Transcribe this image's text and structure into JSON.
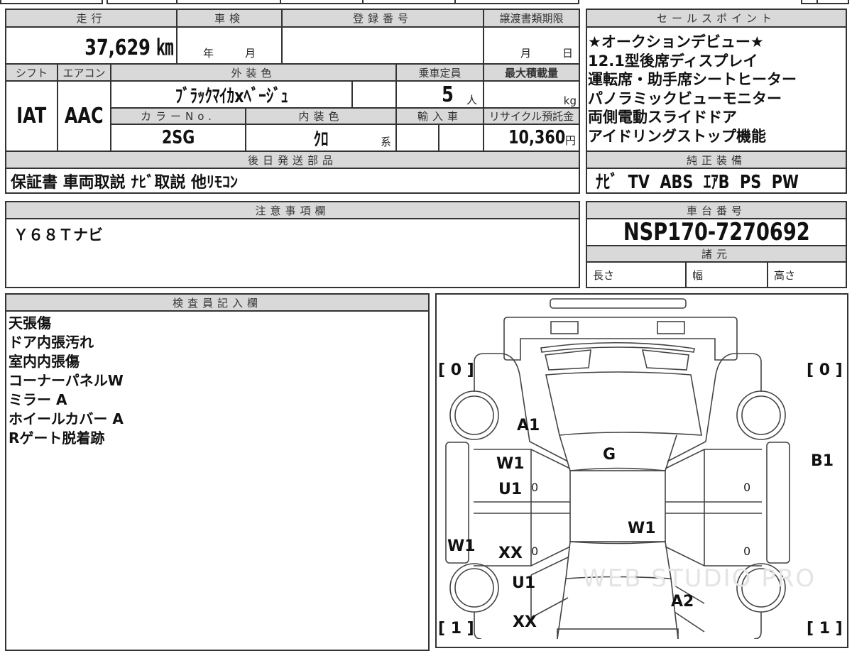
{
  "vehicle": {
    "mileage_label": "走行",
    "mileage_value": "37,629 ㎞",
    "inspection_label": "車検",
    "inspection_year": "年",
    "inspection_month": "月",
    "registration_label": "登録番号",
    "transfer_deadline_label": "譲渡書類期限",
    "transfer_month": "月",
    "transfer_day": "日",
    "shift_label": "シフト",
    "shift_value": "IAT",
    "aircon_label": "エアコン",
    "aircon_value": "AAC",
    "exterior_color_label": "外装色",
    "exterior_color_value": "ﾌﾞﾗｯｸﾏｲｶxﾍﾞｰｼﾞｭ",
    "capacity_label": "乗車定員",
    "capacity_value": "5",
    "capacity_unit": "人",
    "max_load_label": "最大積載量",
    "max_load_unit": "kg",
    "color_no_label": "カラーNo.",
    "color_no_value": "2SG",
    "interior_color_label": "内装色",
    "interior_color_value": "ｸﾛ",
    "interior_color_suffix": "系",
    "import_label": "輸入車",
    "recycle_label": "リサイクル預託金",
    "recycle_value": "10,360",
    "recycle_unit": "円",
    "later_parts_label": "後日発送部品",
    "later_parts_value": "保証書 車両取説 ﾅﾋﾞ取説 他ﾘﾓｺﾝ"
  },
  "sales_points": {
    "label": "セールスポイント",
    "items": [
      "★オークションデビュー★",
      "12.1型後席ディスプレイ",
      "運転席・助手席シートヒーター",
      "パノラミックビューモニター",
      "両側電動スライドドア",
      "アイドリングストップ機能"
    ]
  },
  "equipment": {
    "label": "純正装備",
    "value": "ﾅﾋﾞ  TV  ABS  ｴｱB  PS  PW"
  },
  "notes": {
    "label": "注意事項欄",
    "value": "Ｙ６８Ｔナビ"
  },
  "chassis": {
    "label": "車台番号",
    "value": "NSP170-7270692",
    "spec_label": "諸元",
    "length": "長さ",
    "width": "幅",
    "height": "高さ"
  },
  "inspector": {
    "label": "検査員記入欄",
    "items": [
      "天張傷",
      "ドア内張汚れ",
      "室内内張傷",
      "コーナーパネルW",
      "ミラー A",
      "ホイールカバー A",
      "Rゲート脱着跡"
    ]
  },
  "diagram": {
    "tires": {
      "front_left": "[ 0 ]",
      "front_right": "[ 0 ]",
      "rear_left": "[ 1 ]",
      "rear_right": "[ 1 ]"
    },
    "marks": {
      "a1": "A1",
      "g": "G",
      "w1_fl_door": "W1",
      "u1_fl_door": "U1",
      "b1": "B1",
      "zero1": "0",
      "zero2": "0",
      "zero3": "0",
      "zero4": "0",
      "w1_roof": "W1",
      "w1_side": "W1",
      "xx_rl_door": "XX",
      "u1_rear": "U1",
      "a2": "A2",
      "xx_rear": "XX"
    },
    "watermark": "WEB STUDIO PRO"
  }
}
